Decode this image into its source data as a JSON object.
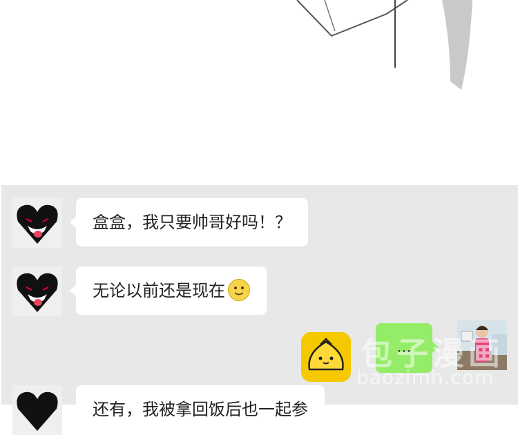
{
  "messages": [
    {
      "sender": "shadow-cat",
      "text": "盒盒，我只要帅哥好吗！？"
    },
    {
      "sender": "shadow-cat",
      "text": "无论以前还是现在",
      "emoji": "smiling-face-icon"
    },
    {
      "sender": "self",
      "text": "..."
    },
    {
      "sender": "shadow-cat",
      "text": "还有，我被拿回饭后也一起参"
    }
  ],
  "self_avatar": "photo-avatar",
  "sticker": "steamed-bun-sticker",
  "watermark": {
    "chinese": "包子漫画",
    "latin": "baozimh.com"
  },
  "colors": {
    "chat_bg": "#e8e8e8",
    "bubble_in": "#ffffff",
    "bubble_out": "#95ec69",
    "sticker_bg": "#f5c800"
  }
}
